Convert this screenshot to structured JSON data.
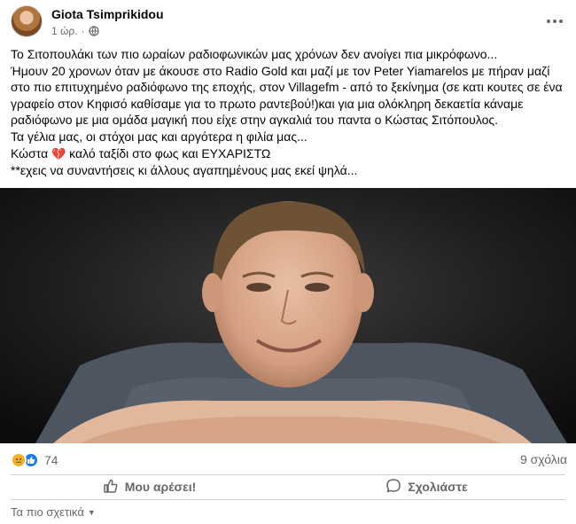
{
  "post": {
    "author": "Giota Tsimprikidou",
    "time": "1 ώρ.",
    "dot": "·",
    "text_lines": [
      "Το Σιτοπουλάκι των πιο ωραίων ραδιοφωνικών μας χρόνων δεν ανοίγει πια μικρόφωνο...",
      "Ήμουν 20 χρονων όταν με άκουσε στο Radio Gold και μαζί με τον Peter Yiamarelos με πήραν μαζί στο πιο επιτυχημένο ραδιόφωνο της εποχής, στον Villagefm - από το ξεκίνημα (σε κατι κουτες σε ένα γραφείο στον Κηφισό καθίσαμε για το πρωτο ραντεβού!)και για μια ολόκληρη δεκαετία κάναμε ραδιόφωνο με μια ομάδα μαγική που είχε στην αγκαλιά του παντα ο Κώστας Σιτόπουλος.",
      "Τα γέλια μας, οι στόχοι μας και αργότερα η φιλία μας...",
      "**εχεις να συναντήσεις κι άλλους αγαπημένους μας εκεί ψηλά..."
    ],
    "kosta_before": "Κώστα",
    "kosta_heart": "💔",
    "kosta_after": " καλό ταξίδι στο φως και ΕΥΧΑΡΙΣΤΩ"
  },
  "engagement": {
    "reaction_count": "74",
    "comments": "9 σχόλια"
  },
  "actions": {
    "like": "Μου αρέσει!",
    "comment": "Σχολιάστε"
  },
  "sort": {
    "label": "Τα πιο σχετικά"
  },
  "colors": {
    "secondary_text": "#65676b",
    "like_blue": "#1877f2",
    "sad_yellow": "#f7b125",
    "heart_red": "#e0245e"
  }
}
